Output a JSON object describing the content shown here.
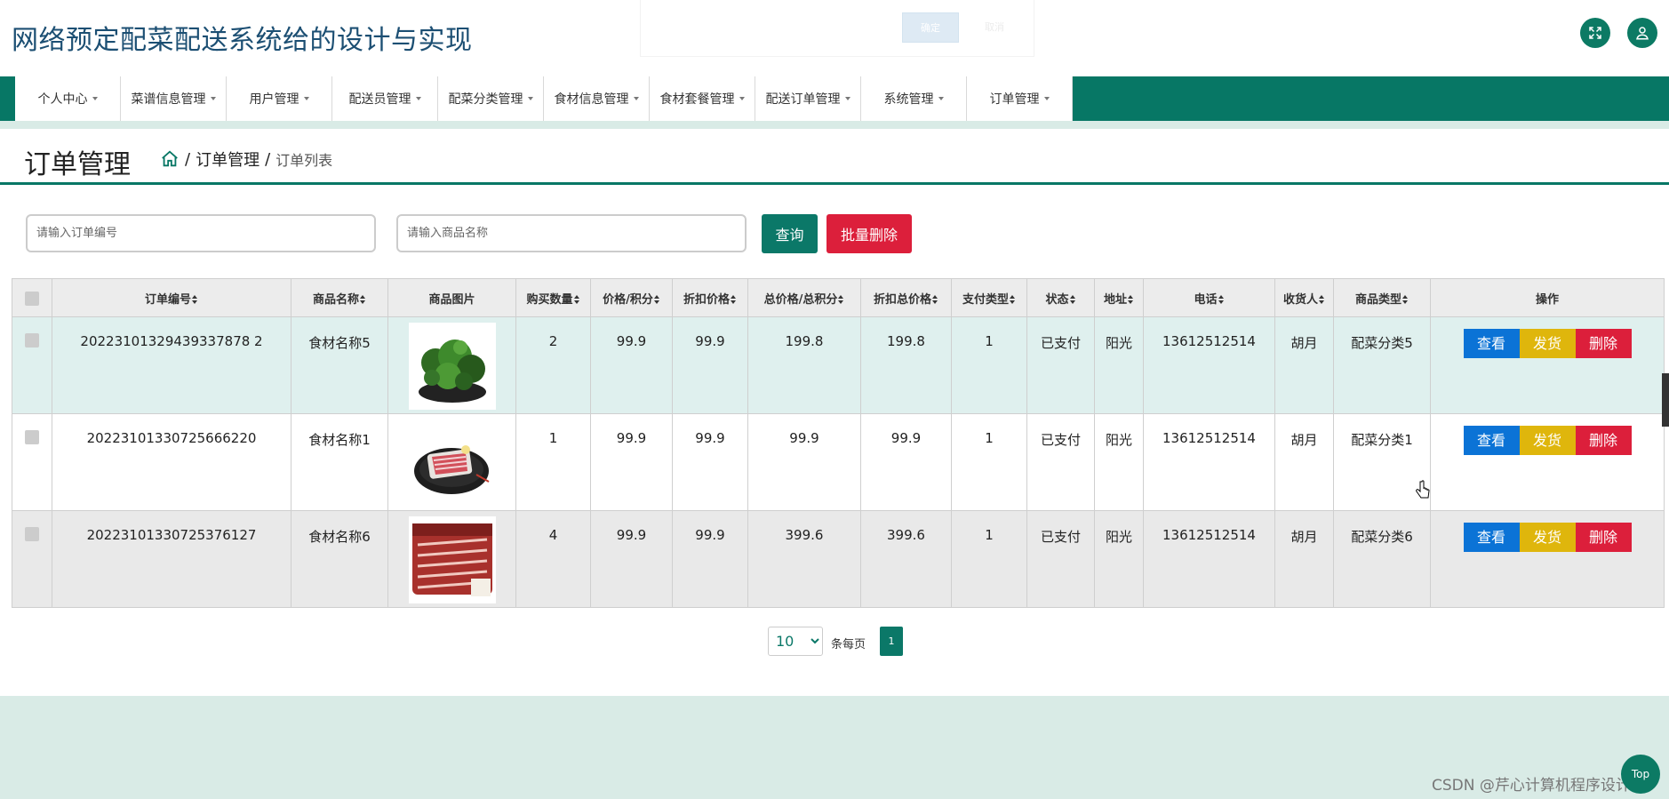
{
  "header": {
    "title": "网络预定配菜配送系统给的设计与实现",
    "dialog_ok": "确定",
    "dialog_cancel": "取消",
    "fullscreen_icon": "expand-icon",
    "user_icon": "user-icon"
  },
  "nav": {
    "items": [
      {
        "label": "个人中心"
      },
      {
        "label": "菜谱信息管理"
      },
      {
        "label": "用户管理"
      },
      {
        "label": "配送员管理"
      },
      {
        "label": "配菜分类管理"
      },
      {
        "label": "食材信息管理"
      },
      {
        "label": "食材套餐管理"
      },
      {
        "label": "配送订单管理"
      },
      {
        "label": "系统管理"
      },
      {
        "label": "订单管理"
      }
    ]
  },
  "page": {
    "title": "订单管理",
    "breadcrumb_home_icon": "home-icon",
    "breadcrumb_parent": "订单管理",
    "breadcrumb_current": "订单列表"
  },
  "search": {
    "order_placeholder": "请输入订单编号",
    "product_placeholder": "请输入商品名称",
    "query_label": "查询",
    "batch_delete_label": "批量删除"
  },
  "table": {
    "headers": [
      "订单编号",
      "商品名称",
      "商品图片",
      "购买数量",
      "价格/积分",
      "折扣价格",
      "总价格/总积分",
      "折扣总价格",
      "支付类型",
      "状态",
      "地址",
      "电话",
      "收货人",
      "商品类型",
      "操作"
    ],
    "rows": [
      {
        "order_no": "20223101329439337878 2",
        "name": "食材名称5",
        "qty": "2",
        "price": "99.9",
        "discount": "99.9",
        "total": "199.8",
        "discount_total": "199.8",
        "pay_type": "1",
        "status": "已支付",
        "address": "阳光",
        "phone": "13612512514",
        "receiver": "胡月",
        "category": "配菜分类5"
      },
      {
        "order_no": "20223101330725666220",
        "name": "食材名称1",
        "qty": "1",
        "price": "99.9",
        "discount": "99.9",
        "total": "99.9",
        "discount_total": "99.9",
        "pay_type": "1",
        "status": "已支付",
        "address": "阳光",
        "phone": "13612512514",
        "receiver": "胡月",
        "category": "配菜分类1"
      },
      {
        "order_no": "20223101330725376127",
        "name": "食材名称6",
        "qty": "4",
        "price": "99.9",
        "discount": "99.9",
        "total": "399.6",
        "discount_total": "399.6",
        "pay_type": "1",
        "status": "已支付",
        "address": "阳光",
        "phone": "13612512514",
        "receiver": "胡月",
        "category": "配菜分类6"
      }
    ],
    "actions": {
      "view": "查看",
      "ship": "发货",
      "delete": "删除"
    }
  },
  "pager": {
    "page_size": "10",
    "per_page_label": "条每页",
    "current_page": "1"
  },
  "footer": {
    "watermark": "CSDN @芹心计算机程序设计",
    "top_button": "Top"
  },
  "colors": {
    "primary": "#077765",
    "danger": "#dc1f3b",
    "info": "#0b73d6",
    "warning": "#dfb60c"
  }
}
